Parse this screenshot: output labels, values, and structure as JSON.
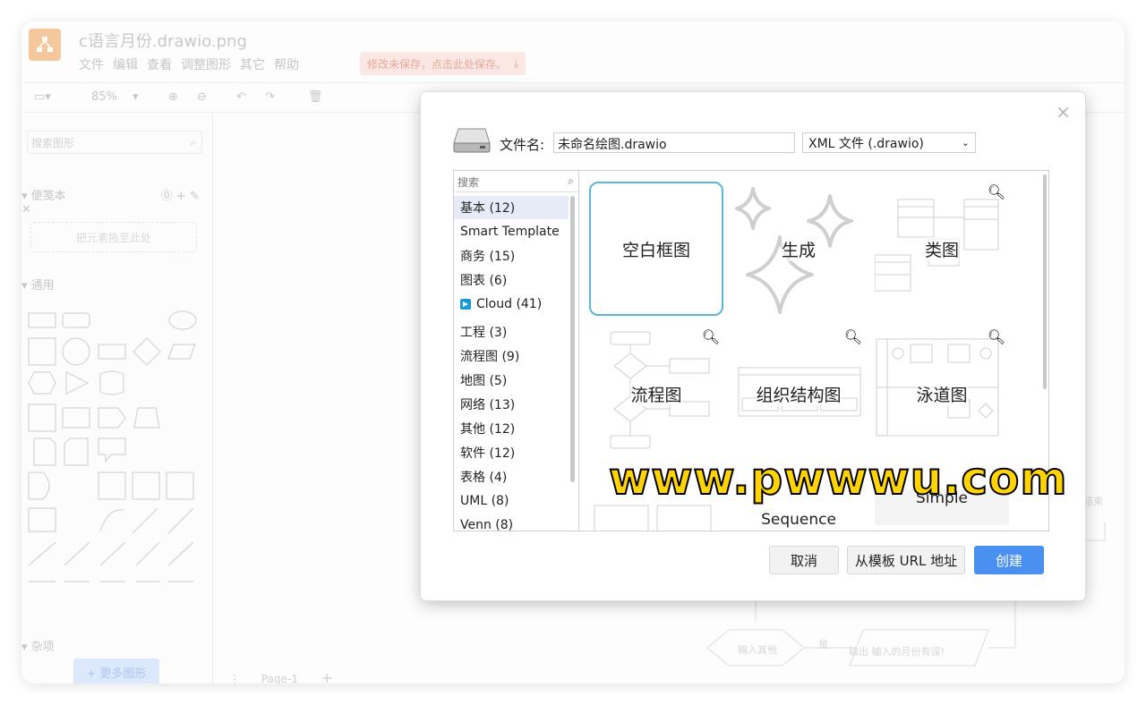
{
  "app": {
    "title": "c语言月份.drawio.png",
    "menu": [
      "文件",
      "编辑",
      "查看",
      "调整图形",
      "其它",
      "帮助"
    ],
    "unsaved_notice": "修改未保存，点击此处保存。",
    "zoom": "85%"
  },
  "sidebar": {
    "search_placeholder": "搜索图形",
    "scratchpad_title": "便笺本",
    "scratchpad_drop": "把元素拖至此处",
    "general_title": "通用",
    "misc_title": "杂项",
    "more_shapes": "+ 更多图形"
  },
  "pagebar": {
    "page_label": "Page-1"
  },
  "canvas_ghost": {
    "node1": "输入其他",
    "edge_label": "是",
    "node2": "输出 输入的月份有误!",
    "node3": "结束"
  },
  "dialog": {
    "filename_label": "文件名:",
    "filename_value": "未命名绘图.drawio",
    "format": "XML 文件 (.drawio)",
    "search_placeholder": "搜索",
    "categories": [
      {
        "label": "基本 (12)",
        "selected": true
      },
      {
        "label": "Smart Template",
        "selected": false
      },
      {
        "label": "商务 (15)",
        "selected": false
      },
      {
        "label": "图表 (6)",
        "selected": false
      },
      {
        "label": "Cloud (41)",
        "selected": false,
        "icon": "cloud-provider-icon"
      },
      {
        "label": "工程 (3)",
        "selected": false
      },
      {
        "label": "流程图 (9)",
        "selected": false
      },
      {
        "label": "地图 (5)",
        "selected": false
      },
      {
        "label": "网络 (13)",
        "selected": false
      },
      {
        "label": "其他 (12)",
        "selected": false
      },
      {
        "label": "软件 (12)",
        "selected": false
      },
      {
        "label": "表格 (4)",
        "selected": false
      },
      {
        "label": "UML (8)",
        "selected": false
      },
      {
        "label": "Venn (8)",
        "selected": false
      }
    ],
    "templates": [
      {
        "label": "空白框图",
        "selected": true
      },
      {
        "label": "生成",
        "selected": false
      },
      {
        "label": "类图",
        "selected": false
      },
      {
        "label": "流程图",
        "selected": false
      },
      {
        "label": "组织结构图",
        "selected": false
      },
      {
        "label": "泳道图",
        "selected": false
      },
      {
        "label": "",
        "selected": false
      },
      {
        "label": "Sequence",
        "selected": false
      },
      {
        "label": "Simple",
        "selected": false
      }
    ],
    "buttons": {
      "cancel": "取消",
      "from_url": "从模板 URL 地址",
      "create": "创建"
    },
    "accent_color": "#4a90f0"
  },
  "watermark": "www.pwwwu.com"
}
